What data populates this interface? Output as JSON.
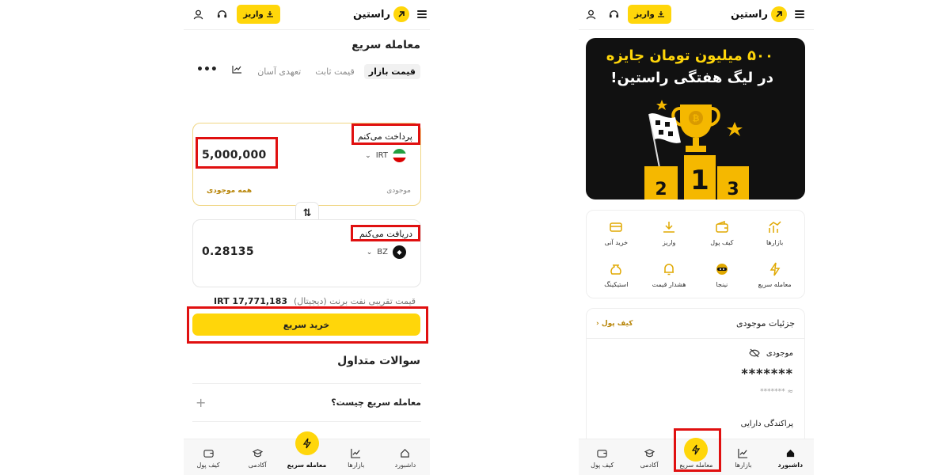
{
  "left": {
    "brand": "راستین",
    "deposit_label": "واریز",
    "page_title": "معامله سریع",
    "tabs": [
      {
        "label": "قیمت بازار",
        "active": true
      },
      {
        "label": "قیمت ثابت",
        "active": false
      },
      {
        "label": "تعهدی آسان",
        "active": false
      }
    ],
    "pay": {
      "label": "پرداخت می‌کنم",
      "amount": "5,000,000",
      "currency": "IRT",
      "balance_label": "موجودی",
      "all_balance_label": "همه موجودی"
    },
    "receive": {
      "label": "دریافت می‌کنم",
      "amount": "0.28135",
      "currency": "BZ"
    },
    "estimate": {
      "label": "قیمت تقریبی نفت برنت (دیجیتال)",
      "value": "17,771,183 IRT"
    },
    "buy_label": "خرید سریع",
    "faq_title": "سوالات متداول",
    "faq_items": [
      {
        "q": "معامله سریع چیست؟"
      }
    ]
  },
  "right": {
    "brand": "راستین",
    "deposit_label": "واریز",
    "banner": {
      "line1": "۵۰۰ میلیون تومان جایزه",
      "line2": "در لیگ هفتگی راستین!",
      "podium": [
        "2",
        "1",
        "3"
      ]
    },
    "services": [
      {
        "label": "بازارها",
        "icon": "chart-icon"
      },
      {
        "label": "کیف پول",
        "icon": "wallet-icon"
      },
      {
        "label": "واریز",
        "icon": "download-icon"
      },
      {
        "label": "خرید آنی",
        "icon": "card-icon"
      },
      {
        "label": "معامله سریع",
        "icon": "bolt-icon"
      },
      {
        "label": "نینجا",
        "icon": "ninja-icon"
      },
      {
        "label": "هشدار قیمت",
        "icon": "bell-icon"
      },
      {
        "label": "استیکینگ",
        "icon": "bag-icon"
      }
    ],
    "wallet": {
      "title": "جزئیات موجودی",
      "link": "کیف پول",
      "balance_label": "موجودی",
      "balance_value": "*******",
      "balance_sub": "******* ≈",
      "distribution_label": "پراکندگی دارایی"
    }
  },
  "nav_left": [
    {
      "label": "داشبورد",
      "icon": "home-icon",
      "active": false
    },
    {
      "label": "بازارها",
      "icon": "chart-icon",
      "active": false
    },
    {
      "label": "معامله سریع",
      "icon": "bolt-icon",
      "active": true
    },
    {
      "label": "آکادمی",
      "icon": "academy-icon",
      "active": false
    },
    {
      "label": "کیف پول",
      "icon": "wallet-icon",
      "active": false
    }
  ],
  "nav_right": [
    {
      "label": "داشبورد",
      "icon": "home-icon",
      "active": true
    },
    {
      "label": "بازارها",
      "icon": "chart-icon",
      "active": false
    },
    {
      "label": "معامله سریع",
      "icon": "bolt-icon",
      "active": false
    },
    {
      "label": "آکادمی",
      "icon": "academy-icon",
      "active": false
    },
    {
      "label": "کیف پول",
      "icon": "wallet-icon",
      "active": false
    }
  ],
  "colors": {
    "accent": "#ffd60a",
    "highlight": "#e01010",
    "link": "#b8860b"
  }
}
